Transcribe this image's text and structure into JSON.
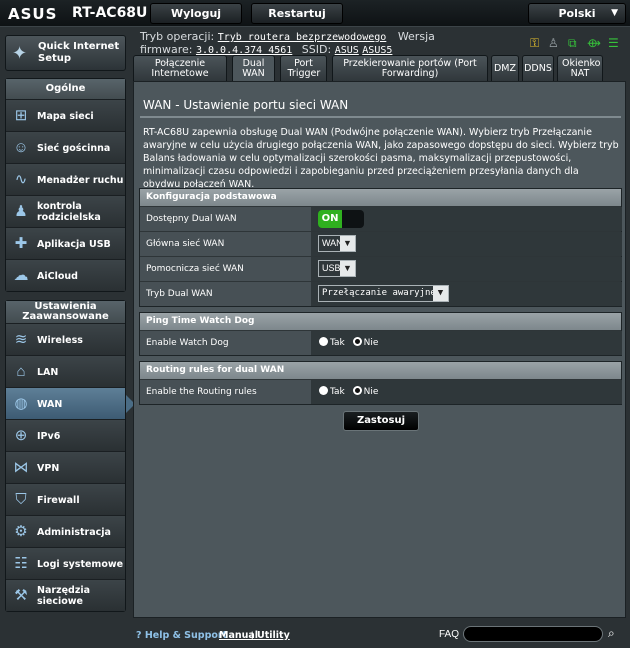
{
  "header": {
    "brand": "ASUS",
    "model": "RT-AC68U",
    "logout_label": "Wyloguj",
    "restart_label": "Restartuj",
    "language": "Polski",
    "op_mode_label": "Tryb operacji:",
    "op_mode_value": "Tryb routera bezprzewodowego",
    "version_label": "Wersja",
    "firmware_label": "firmware:",
    "firmware_value": "3.0.0.4.374_4561",
    "ssid_label": "SSID:",
    "ssid_1": "ASUS",
    "ssid_2": "ASUS5"
  },
  "status_icons": [
    "key-icon",
    "clients-icon",
    "network-icon",
    "usb-icon",
    "menu-icon"
  ],
  "quick_setup": {
    "label_line1": "Quick Internet",
    "label_line2": "Setup"
  },
  "sidebar": {
    "general_title": "Ogólne",
    "general_items": [
      {
        "label": "Mapa sieci",
        "icon": "network-map-icon"
      },
      {
        "label": "Sieć gościnna",
        "icon": "guest-network-icon"
      },
      {
        "label": "Menadżer ruchu",
        "icon": "traffic-manager-icon"
      },
      {
        "label": "kontrola rodzicielska",
        "icon": "parental-control-icon"
      },
      {
        "label": "Aplikacja USB",
        "icon": "usb-app-icon"
      },
      {
        "label": "AiCloud",
        "icon": "aicloud-icon"
      }
    ],
    "advanced_title_1": "Ustawienia",
    "advanced_title_2": "Zaawansowane",
    "advanced_items": [
      {
        "label": "Wireless",
        "icon": "wireless-icon"
      },
      {
        "label": "LAN",
        "icon": "lan-icon"
      },
      {
        "label": "WAN",
        "icon": "wan-icon"
      },
      {
        "label": "IPv6",
        "icon": "ipv6-icon"
      },
      {
        "label": "VPN",
        "icon": "vpn-icon"
      },
      {
        "label": "Firewall",
        "icon": "firewall-icon"
      },
      {
        "label": "Administracja",
        "icon": "administration-icon"
      },
      {
        "label": "Logi systemowe",
        "icon": "system-log-icon"
      },
      {
        "label": "Narzędzia sieciowe",
        "icon": "network-tools-icon"
      }
    ]
  },
  "tabs": [
    {
      "label": "Połączenie Internetowe"
    },
    {
      "label": "Dual WAN"
    },
    {
      "label": "Port Trigger"
    },
    {
      "label": "Przekierowanie portów (Port Forwarding)"
    },
    {
      "label": "DMZ"
    },
    {
      "label": "DDNS"
    },
    {
      "label": "Okienko NAT"
    }
  ],
  "main": {
    "title": "WAN - Ustawienie portu sieci WAN",
    "description": "RT-AC68U zapewnia obsługę Dual WAN (Podwójne połączenie WAN). Wybierz tryb Przełączanie awaryjne w celu użycia drugiego połączenia WAN, jako zapasowego dopstępu do sieci. Wybierz tryb Balans ładowania w celu optymalizacji szerokości pasma, maksymalizacji przepustowości, minimalizacji czasu odpowiedzi i zapobieganiu przed przeciążeniem przesyłania danych dla obydwu połączeń WAN.",
    "basic": {
      "header": "Konfiguracja podstawowa",
      "dual_wan_label": "Dostępny Dual WAN",
      "dual_wan_value": "ON",
      "primary_label": "Główna sieć WAN",
      "primary_value": "WAN",
      "secondary_label": "Pomocnicza sieć WAN",
      "secondary_value": "USB",
      "mode_label": "Tryb Dual WAN",
      "mode_value": "Przełączanie awaryjne"
    },
    "watchdog": {
      "header": "Ping Time Watch Dog",
      "label": "Enable Watch Dog",
      "yes": "Tak",
      "no": "Nie"
    },
    "routing": {
      "header": "Routing rules for dual WAN",
      "label": "Enable the Routing rules",
      "yes": "Tak",
      "no": "Nie"
    },
    "apply_label": "Zastosuj"
  },
  "footer": {
    "help_label": "Help & Support",
    "manual_label": "Manual",
    "separator": "|",
    "utility_label": "Utility",
    "faq_label": "FAQ",
    "faq_placeholder": ""
  }
}
